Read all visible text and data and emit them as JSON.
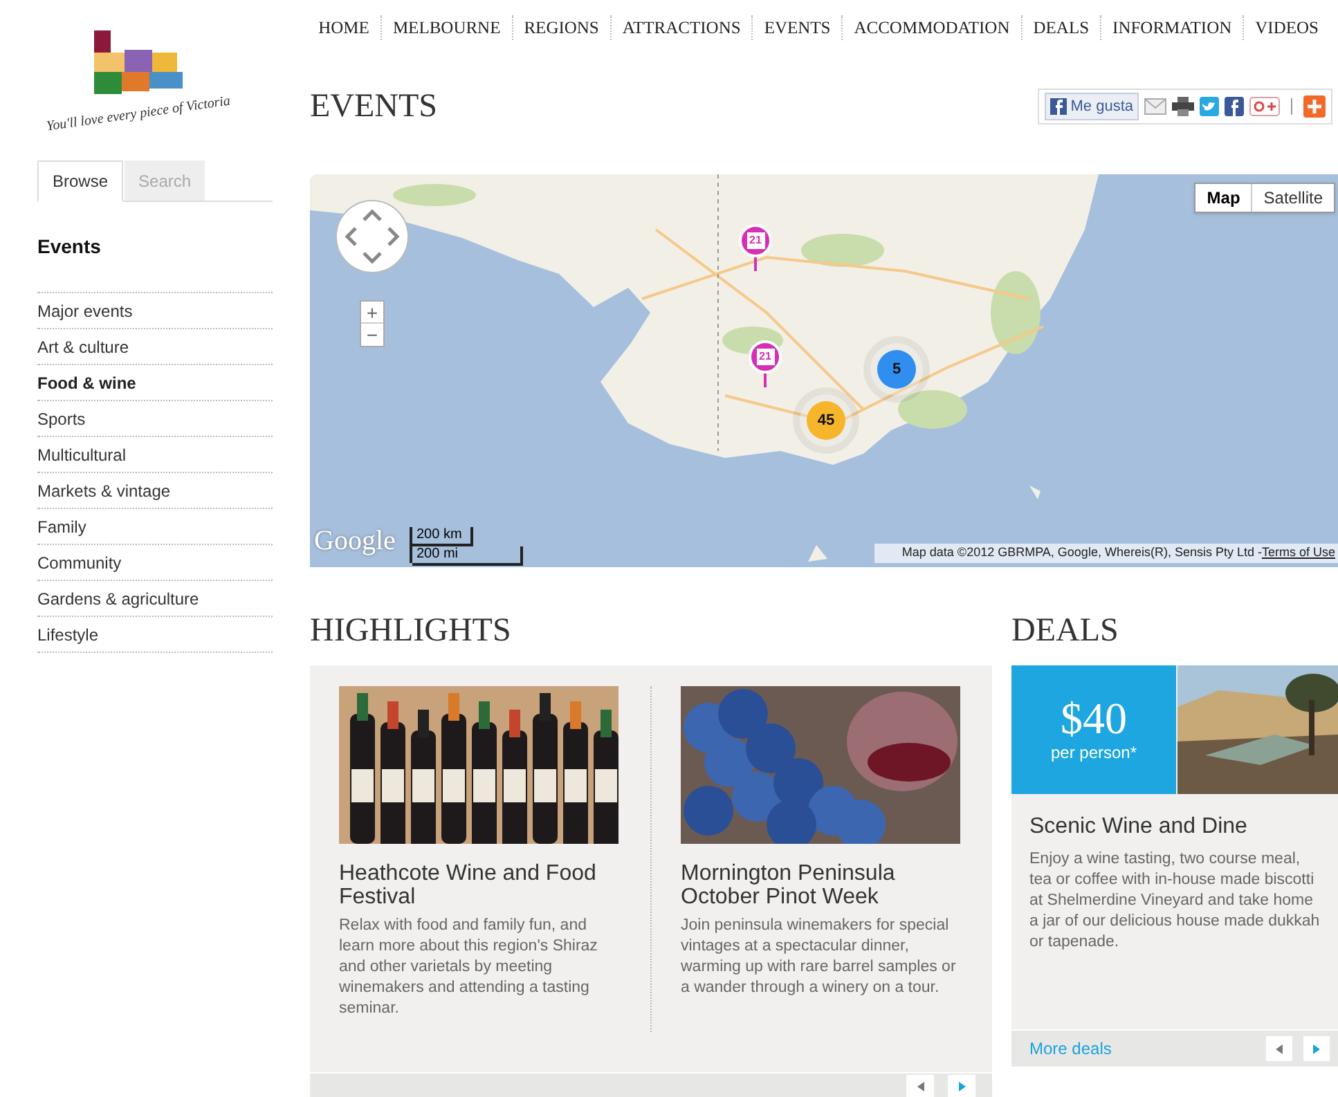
{
  "logo": {
    "tagline": "You'll love every piece of Victoria"
  },
  "nav": [
    {
      "label": "HOME"
    },
    {
      "label": "MELBOURNE"
    },
    {
      "label": "REGIONS"
    },
    {
      "label": "ATTRACTIONS"
    },
    {
      "label": "EVENTS"
    },
    {
      "label": "ACCOMMODATION"
    },
    {
      "label": "DEALS"
    },
    {
      "label": "INFORMATION"
    },
    {
      "label": "VIDEOS"
    }
  ],
  "sidebar": {
    "tabs": [
      {
        "label": "Browse",
        "selected": true
      },
      {
        "label": "Search",
        "selected": false
      }
    ],
    "heading": "Events",
    "items": [
      {
        "label": "Major events",
        "selected": false
      },
      {
        "label": "Art & culture",
        "selected": false
      },
      {
        "label": "Food & wine",
        "selected": true
      },
      {
        "label": "Sports",
        "selected": false
      },
      {
        "label": "Multicultural",
        "selected": false
      },
      {
        "label": "Markets & vintage",
        "selected": false
      },
      {
        "label": "Family",
        "selected": false
      },
      {
        "label": "Community",
        "selected": false
      },
      {
        "label": "Gardens & agriculture",
        "selected": false
      },
      {
        "label": "Lifestyle",
        "selected": false
      }
    ]
  },
  "page_title": "EVENTS",
  "share": {
    "like": "Me gusta"
  },
  "map": {
    "map_types": [
      {
        "label": "Map",
        "selected": true
      },
      {
        "label": "Satellite",
        "selected": false
      }
    ],
    "zoom_in": "+",
    "zoom_out": "−",
    "markers": [
      {
        "kind": "event",
        "label": "21"
      },
      {
        "kind": "event",
        "label": "21"
      },
      {
        "kind": "cluster",
        "label": "5",
        "color": "#2f8ef0"
      },
      {
        "kind": "cluster",
        "label": "45",
        "color": "#f7b52c"
      }
    ],
    "logo": "Google",
    "scale_km": "200 km",
    "scale_mi": "200 mi",
    "attribution": "Map data ©2012 GBRMPA, Google, Whereis(R), Sensis Pty Ltd - ",
    "terms_link": "Terms of Use"
  },
  "highlights": {
    "heading": "HIGHLIGHTS",
    "items": [
      {
        "kind": "bottles",
        "title": "Heathcote Wine and Food Festival",
        "text": "Relax with food and family fun, and learn more about this region's Shiraz and other varietals by meeting winemakers and attending a tasting seminar."
      },
      {
        "kind": "grapes",
        "title": "Mornington Peninsula October Pinot Week",
        "text": "Join peninsula winemakers for special vintages at a spectacular dinner, warming up with rare barrel samples or a wander through a winery on a tour."
      }
    ]
  },
  "deals": {
    "heading": "DEALS",
    "price": "$40",
    "unit": "per person*",
    "title": "Scenic Wine and Dine",
    "text": "Enjoy a wine tasting, two course meal, tea or coffee with in-house made biscotti at Shelmerdine Vineyard and take home a jar of our delicious house made dukkah or tapenade.",
    "link": "More deals"
  }
}
